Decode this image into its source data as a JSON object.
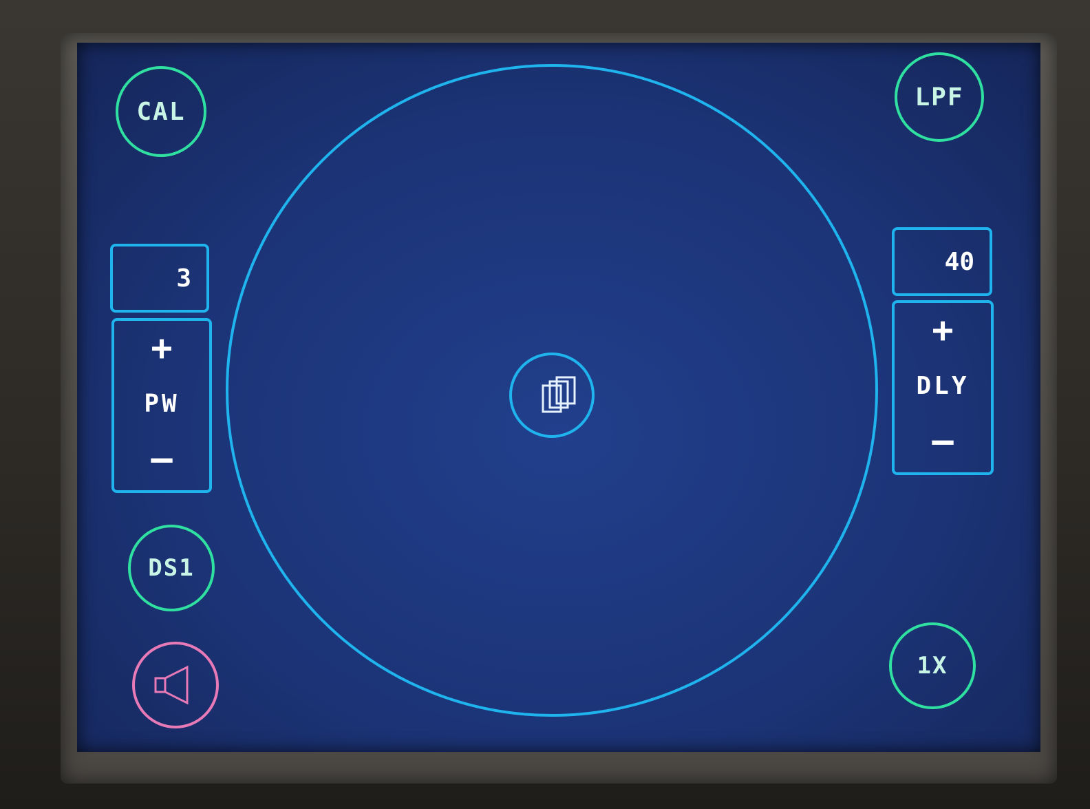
{
  "buttons": {
    "cal_label": "CAL",
    "lpf_label": "LPF",
    "ds_label": "DS1",
    "zoom_label": "1X"
  },
  "left_control": {
    "value": "3",
    "plus": "+",
    "label": "PW",
    "minus": "—"
  },
  "right_control": {
    "value": "40",
    "plus": "+",
    "label": "DLY",
    "minus": "—"
  },
  "icons": {
    "center": "stacked-squares-icon",
    "speaker": "speaker-icon"
  },
  "colors": {
    "screen_bg": "#1c3477",
    "accent_cyan": "#1fb4ee",
    "button_green": "#2fe0a0",
    "speaker_pink": "#e87ab8"
  }
}
